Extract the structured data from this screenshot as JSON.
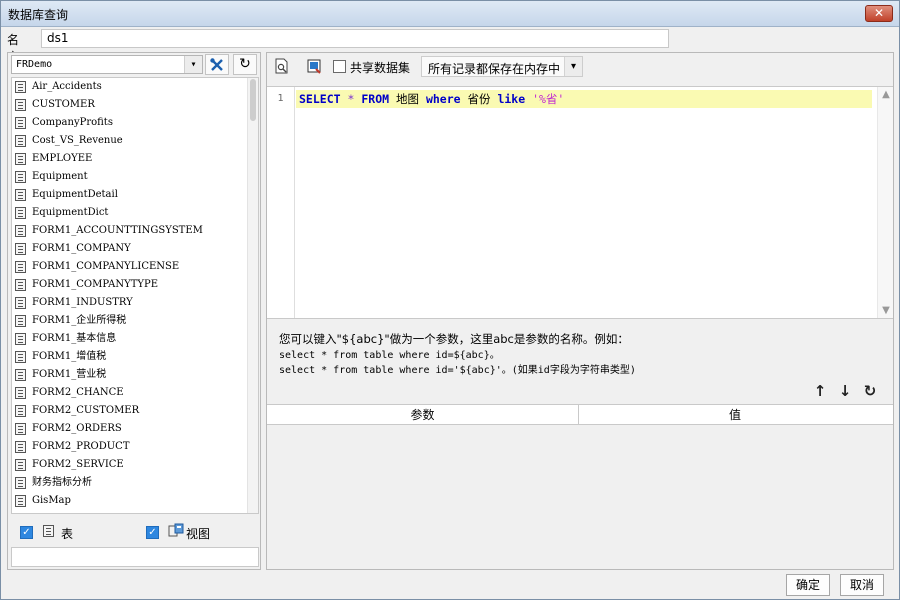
{
  "window": {
    "title": "数据库查询",
    "close_label": "✕"
  },
  "name_field": {
    "label": "名字:",
    "value": "ds1"
  },
  "connection": {
    "selected": "FRDemo"
  },
  "tables": [
    "Air_Accidents",
    "CUSTOMER",
    "CompanyProfits",
    "Cost_VS_Revenue",
    "EMPLOYEE",
    "Equipment",
    "EquipmentDetail",
    "EquipmentDict",
    "FORM1_ACCOUNTTINGSYSTEM",
    "FORM1_COMPANY",
    "FORM1_COMPANYLICENSE",
    "FORM1_COMPANYTYPE",
    "FORM1_INDUSTRY",
    "FORM1_企业所得税",
    "FORM1_基本信息",
    "FORM1_增值税",
    "FORM1_营业税",
    "FORM2_CHANCE",
    "FORM2_CUSTOMER",
    "FORM2_ORDERS",
    "FORM2_PRODUCT",
    "FORM2_SERVICE",
    "财务指标分析",
    "GisMap"
  ],
  "filters": {
    "table_label": "表",
    "view_label": "视图"
  },
  "toolbar": {
    "share_label": "共享数据集",
    "memory_option": "所有记录都保存在内存中"
  },
  "editor": {
    "line_number": "1",
    "tokens": {
      "select": "SELECT",
      "star": "*",
      "from": "FROM",
      "table": "地图",
      "where": "where",
      "column": "省份",
      "like": "like",
      "pattern": "'%省'"
    }
  },
  "hint": {
    "line1": "您可以键入\"${abc}\"做为一个参数，这里abc是参数的名称。例如：",
    "line2": "select * from table where id=${abc}。",
    "line3": "select * from table where id='${abc}'。(如果id字段为字符串类型)"
  },
  "params": {
    "col_param": "参数",
    "col_value": "值"
  },
  "buttons": {
    "ok": "确定",
    "cancel": "取消"
  }
}
